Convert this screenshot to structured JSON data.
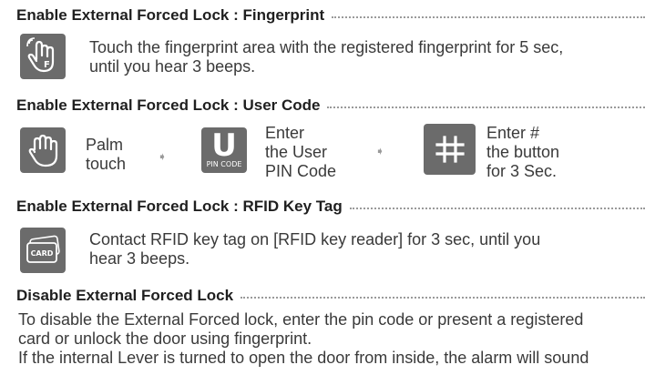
{
  "sections": [
    {
      "heading": "Enable External Forced Lock : Fingerprint",
      "icon": "fingerprint-hand-icon",
      "icon_letter": "F",
      "text_lines": [
        "Touch the fingerprint area with the registered fingerprint for 5 sec,",
        "until you hear 3 beeps."
      ]
    },
    {
      "heading": "Enable External Forced Lock : User Code",
      "steps": [
        {
          "icon": "palm-icon",
          "lines": [
            "Palm",
            "touch"
          ]
        },
        {
          "icon": "pin-code-icon",
          "icon_letter": "U",
          "icon_caption": "PIN CODE",
          "lines": [
            "Enter",
            "the User",
            "PIN Code"
          ]
        },
        {
          "icon": "hash-icon",
          "lines": [
            "Enter #",
            "the button",
            "for 3 Sec."
          ]
        }
      ],
      "arrow": "➧"
    },
    {
      "heading": "Enable External Forced Lock : RFID Key Tag",
      "icon": "card-icon",
      "icon_caption": "CARD",
      "text_lines": [
        "Contact RFID key tag on [RFID key reader] for 3 sec, until you",
        "hear 3 beeps."
      ]
    },
    {
      "heading": "Disable External Forced Lock",
      "text_lines": [
        "To disable the External Forced lock, enter the pin code or present a registered",
        "card or unlock the door using fingerprint.",
        "If the internal Lever is turned to open the door from inside, the alarm will sound"
      ]
    }
  ],
  "colors": {
    "icon_bg": "#6b6b6b",
    "text": "#3a3a3a",
    "heading": "#1f1f1f"
  }
}
